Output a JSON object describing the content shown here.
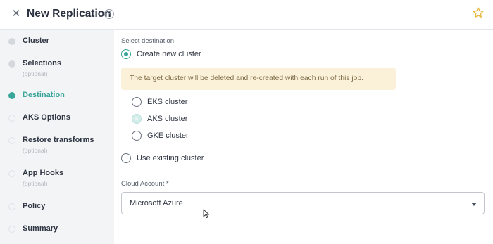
{
  "header": {
    "close_glyph": "✕",
    "title": "New Replication",
    "help_glyph": "?",
    "star_color": "#e7b73b"
  },
  "sidebar": {
    "steps": [
      {
        "label": "Cluster",
        "sub": "",
        "state": "done"
      },
      {
        "label": "Selections",
        "sub": "(optional)",
        "state": "done"
      },
      {
        "label": "Destination",
        "sub": "",
        "state": "active"
      },
      {
        "label": "AKS Options",
        "sub": "",
        "state": "pending"
      },
      {
        "label": "Restore transforms",
        "sub": "(optional)",
        "state": "pending"
      },
      {
        "label": "App Hooks",
        "sub": "(optional)",
        "state": "pending"
      },
      {
        "label": "Policy",
        "sub": "",
        "state": "pending"
      },
      {
        "label": "Summary",
        "sub": "",
        "state": "pending"
      }
    ]
  },
  "main": {
    "section_label": "Select destination",
    "create_new": {
      "label": "Create new cluster",
      "checked": true
    },
    "warning": "The target cluster will be deleted and re-created with each run of this job.",
    "cluster_types": [
      {
        "label": "EKS cluster",
        "state": "unchecked"
      },
      {
        "label": "AKS cluster",
        "state": "selected-disabled"
      },
      {
        "label": "GKE cluster",
        "state": "unchecked"
      }
    ],
    "use_existing": {
      "label": "Use existing cluster",
      "checked": false
    },
    "cloud_account": {
      "label": "Cloud Account *",
      "value": "Microsoft Azure"
    }
  },
  "colors": {
    "accent": "#3aa59a",
    "warning_bg": "#fbf1d9"
  }
}
